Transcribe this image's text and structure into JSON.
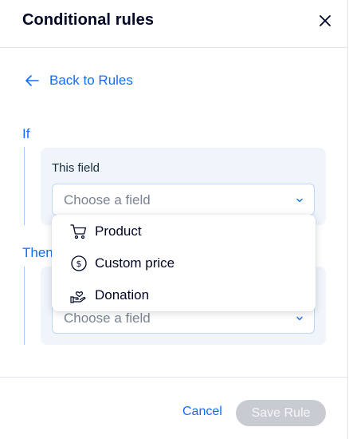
{
  "header": {
    "title": "Conditional rules",
    "close_icon": "close-icon"
  },
  "back": {
    "label": "Back to Rules",
    "icon": "arrow-left-icon"
  },
  "if_section": {
    "label": "If",
    "field_label": "This field",
    "select_placeholder": "Choose a field"
  },
  "then_section": {
    "label": "Then",
    "select_placeholder": "Choose a field"
  },
  "dropdown": {
    "options": [
      {
        "label": "Product",
        "icon": "cart-icon"
      },
      {
        "label": "Custom price",
        "icon": "dollar-coin-icon"
      },
      {
        "label": "Donation",
        "icon": "hand-heart-icon"
      }
    ]
  },
  "footer": {
    "cancel_label": "Cancel",
    "save_label": "Save Rule"
  },
  "colors": {
    "accent": "#116dff",
    "box_bg": "#f0f4fb",
    "disabled_button": "#c8ccd2"
  }
}
